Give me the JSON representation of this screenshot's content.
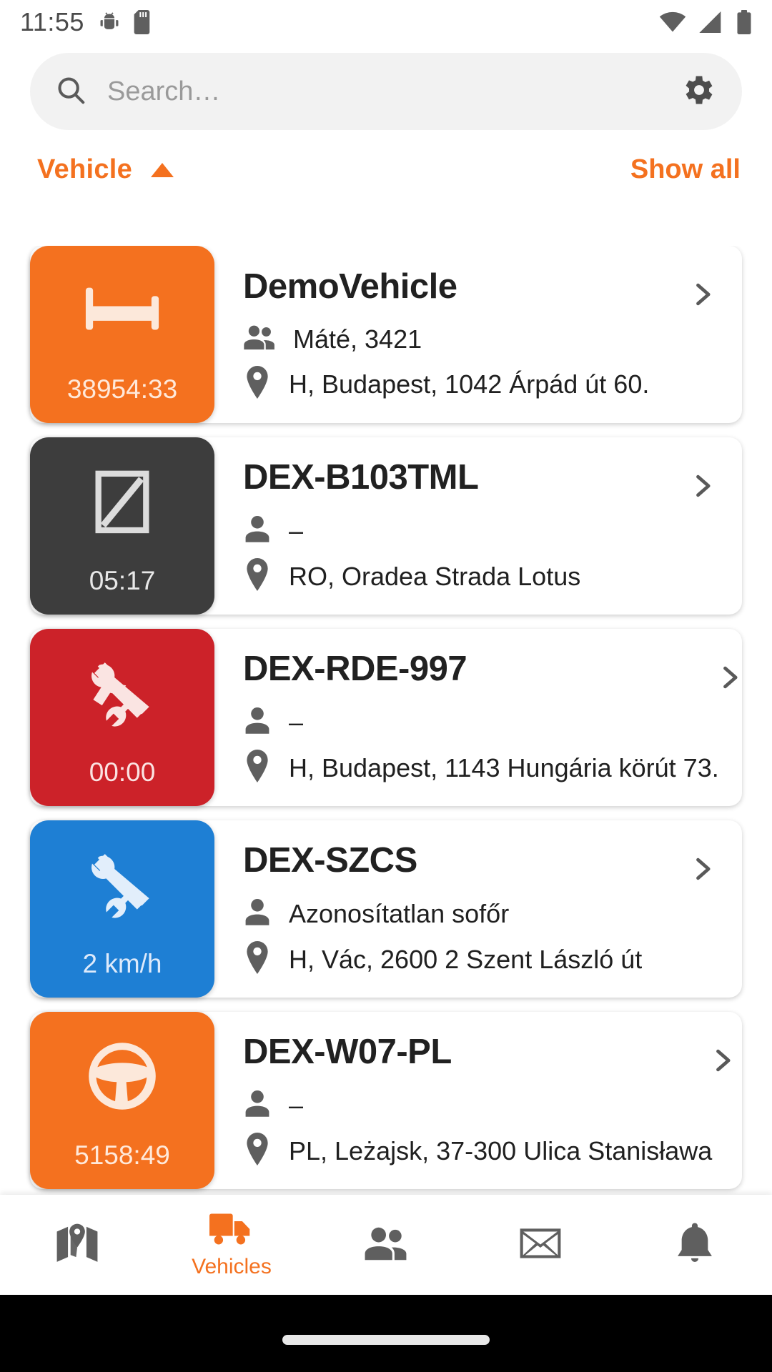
{
  "status_bar": {
    "clock": "11:55",
    "icons": [
      "android-debug-icon",
      "sd-card-icon"
    ],
    "right_icons": [
      "wifi-icon",
      "cellular-signal-icon",
      "battery-icon"
    ]
  },
  "search": {
    "placeholder": "Search…",
    "value": "",
    "search_icon": "search-icon",
    "settings_icon": "gear-icon"
  },
  "filter": {
    "label": "Vehicle",
    "sort_direction": "ascending",
    "show_all_label": "Show all"
  },
  "colors": {
    "accent_orange": "#f4711f",
    "status_rest": "#f4711f",
    "status_unknown": "#3d3d3d",
    "status_work_red": "#cc2229",
    "status_work_blue": "#1e7fd4",
    "status_drive": "#f4711f"
  },
  "vehicles": [
    {
      "name": "DemoVehicle",
      "status_icon": "bed-icon",
      "status_color": "#f4711f",
      "value": "38954:33",
      "driver_icon": "people-icon",
      "driver": "Máté, 3421",
      "location_icon": "location-pin-icon",
      "location": "H, Budapest, 1042 Árpád út 60."
    },
    {
      "name": "DEX-B103TML",
      "status_icon": "crossed-square-icon",
      "status_color": "#3d3d3d",
      "value": "05:17",
      "driver_icon": "person-icon",
      "driver": "–",
      "location_icon": "location-pin-icon",
      "location": "RO, Oradea Strada Lotus"
    },
    {
      "name": "DEX-RDE-997",
      "status_icon": "tools-icon",
      "status_color": "#cc2229",
      "value": "00:00",
      "driver_icon": "person-icon",
      "driver": "–",
      "location_icon": "location-pin-icon",
      "location": "H, Budapest, 1143 Hungária körút 73."
    },
    {
      "name": "DEX-SZCS",
      "status_icon": "tools-icon",
      "status_color": "#1e7fd4",
      "value": "2 km/h",
      "driver_icon": "person-icon",
      "driver": "Azonosítatlan sofőr",
      "location_icon": "location-pin-icon",
      "location": "H, Vác, 2600 2 Szent László út"
    },
    {
      "name": "DEX-W07-PL",
      "status_icon": "steering-wheel-icon",
      "status_color": "#f4711f",
      "value": "5158:49",
      "driver_icon": "person-icon",
      "driver": "–",
      "location_icon": "location-pin-icon",
      "location": "PL, Leżajsk, 37-300 Ulica Stanisława"
    }
  ],
  "bottom_nav": [
    {
      "icon": "map-icon",
      "label": "",
      "active": false
    },
    {
      "icon": "truck-icon",
      "label": "Vehicles",
      "active": true
    },
    {
      "icon": "people-icon",
      "label": "",
      "active": false
    },
    {
      "icon": "envelope-icon",
      "label": "",
      "active": false
    },
    {
      "icon": "bell-icon",
      "label": "",
      "active": false
    }
  ]
}
